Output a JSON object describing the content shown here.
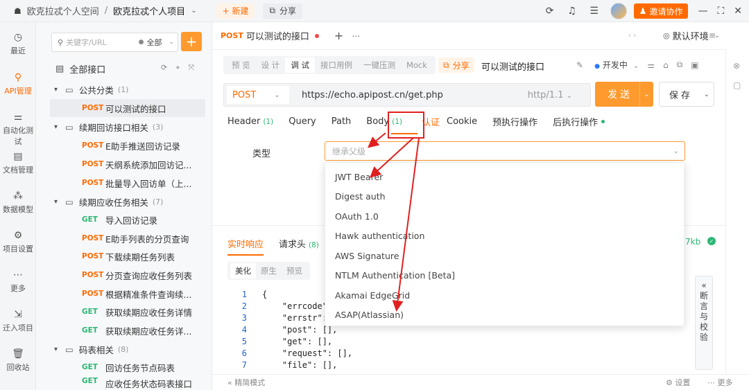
{
  "topbar": {
    "workspace": "欧克拉忒个人空间",
    "separator": "/",
    "project": "欧克拉忒个人项目",
    "new_label": "+ 新建",
    "share_label": "分享",
    "invite_label": "邀请协作"
  },
  "leftnav": [
    {
      "label": "最近",
      "icon": "clock-icon"
    },
    {
      "label": "API管理",
      "icon": "api-icon"
    },
    {
      "label": "自动化测试",
      "icon": "automation-icon"
    },
    {
      "label": "文档管理",
      "icon": "document-icon"
    },
    {
      "label": "数据模型",
      "icon": "model-icon"
    },
    {
      "label": "项目设置",
      "icon": "settings-icon"
    },
    {
      "label": "更多",
      "icon": "more-icon"
    },
    {
      "label": "迁入项目",
      "icon": "import-icon"
    },
    {
      "label": "回收站",
      "icon": "trash-icon"
    }
  ],
  "tree": {
    "search_placeholder": "关键字/URL",
    "filter_label": "全部",
    "root_label": "全部接口",
    "rows": [
      {
        "type": "folder",
        "label": "公共分类",
        "count": "(1)"
      },
      {
        "type": "api",
        "method": "POST",
        "label": "可以测试的接口",
        "selected": true
      },
      {
        "type": "folder",
        "label": "续期回访接口相关",
        "count": "(3)"
      },
      {
        "type": "api",
        "method": "POST",
        "label": "E助手推送回访记录"
      },
      {
        "type": "api",
        "method": "POST",
        "label": "天纲系统添加回访记..."
      },
      {
        "type": "api",
        "method": "POST",
        "label": "批量导入回访单（上..."
      },
      {
        "type": "folder",
        "label": "续期应收任务相关",
        "count": "(7)"
      },
      {
        "type": "api",
        "method": "GET",
        "label": "导入回访记录"
      },
      {
        "type": "api",
        "method": "POST",
        "label": "E助手列表的分页查询"
      },
      {
        "type": "api",
        "method": "POST",
        "label": "下载续期任务列表"
      },
      {
        "type": "api",
        "method": "POST",
        "label": "分页查询应收任务列表"
      },
      {
        "type": "api",
        "method": "POST",
        "label": "根据精准条件查询续..."
      },
      {
        "type": "api",
        "method": "GET",
        "label": "获取续期应收任务详情"
      },
      {
        "type": "api",
        "method": "GET",
        "label": "获取续期应收任务详..."
      },
      {
        "type": "folder",
        "label": "码表相关",
        "count": "(8)"
      },
      {
        "type": "api",
        "method": "GET",
        "label": "回访任务节点码表"
      },
      {
        "type": "api",
        "method": "GET",
        "label": "应收任务状态码表接口"
      }
    ]
  },
  "main": {
    "tab": {
      "method": "POST",
      "title": "可以测试的接口"
    },
    "env_label": "默认环境",
    "subtabs": [
      "预 览",
      "设 计",
      "调 试",
      "接口用例",
      "一键压测",
      "Mock"
    ],
    "active_subtab": 2,
    "share_label": "分享",
    "api_name": "可以测试的接口",
    "status_label": "开发中",
    "method": "POST",
    "url": "https://echo.apipost.cn/get.php",
    "http_version": "http/1.1",
    "send_label": "发送",
    "save_label": "保存",
    "req_tabs": [
      {
        "label": "Header",
        "count": "(1)"
      },
      {
        "label": "Query",
        "count": ""
      },
      {
        "label": "Path",
        "count": ""
      },
      {
        "label": "Body",
        "count": "(1)"
      },
      {
        "label": "认证",
        "count": ""
      },
      {
        "label": "Cookie",
        "count": ""
      },
      {
        "label": "预执行操作",
        "count": ""
      },
      {
        "label": "后执行操作",
        "count": ""
      }
    ],
    "active_req_tab": 4,
    "type_label": "类型",
    "type_placeholder": "继承父级",
    "auth_options": [
      "JWT Bearer",
      "Digest auth",
      "OAuth 1.0",
      "Hawk authentication",
      "AWS Signature",
      "NTLM Authentication [Beta]",
      "Akamai EdgeGrid",
      "ASAP(Atlassian)"
    ],
    "response": {
      "tab_realtime": "实时响应",
      "tab_headers": "请求头",
      "headers_count": "(8)",
      "size": "7kb",
      "formats": [
        "美化",
        "原生",
        "预览"
      ],
      "code_lines": [
        {
          "n": "1",
          "text": "{"
        },
        {
          "n": "2",
          "text": "    \"errcode\""
        },
        {
          "n": "3",
          "text": "    \"errstr\":"
        },
        {
          "n": "4",
          "text": "    \"post\": [],"
        },
        {
          "n": "5",
          "text": "    \"get\": [],"
        },
        {
          "n": "6",
          "text": "    \"request\": [],"
        },
        {
          "n": "7",
          "text": "    \"file\": [],"
        }
      ],
      "assert_label": "« 断言与校验"
    },
    "footer": {
      "mode": "精简模式",
      "settings": "设置",
      "more": "更多"
    }
  },
  "colors": {
    "accent": "#ff6a00",
    "get": "#2bb673",
    "annotation": "#e02020"
  }
}
